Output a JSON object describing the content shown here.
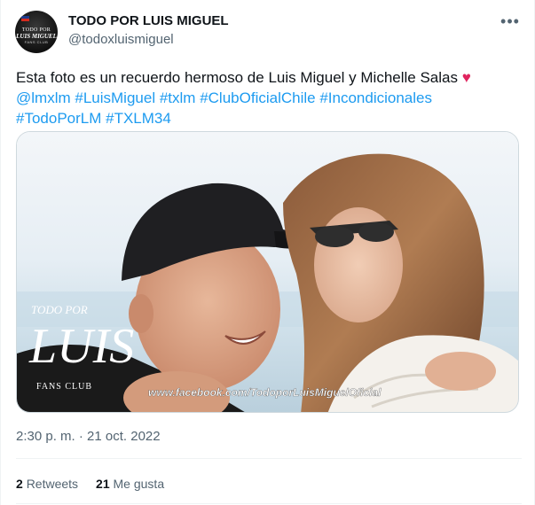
{
  "tweet": {
    "display_name": "TODO POR LUIS MIGUEL",
    "handle": "@todoxluismiguel",
    "avatar": {
      "line1": "TODO POR",
      "line2": "LUIS MIGUEL",
      "line3": "FANS CLUB"
    },
    "more_icon": "more-horizontal-icon",
    "text": "Esta foto es un recuerdo hermoso de Luis Miguel y Michelle Salas",
    "heart": "♥",
    "hashtags": [
      "@lmxlm",
      "#LuisMiguel",
      "#txlm",
      "#ClubOficialChile",
      "#Incondicionales",
      "#TodoPorLM",
      "#TXLM34"
    ],
    "timestamp": "2:30 p. m. · 21 oct. 2022",
    "retweets_count": "2",
    "retweets_label": "Retweets",
    "likes_count": "21",
    "likes_label": "Me gusta"
  },
  "media": {
    "watermark_line1": "TODO POR",
    "watermark_line2": "LUIS",
    "watermark_line3": "FANS CLUB",
    "watermark_url": "www.facebook.com/TodoporLuisMiguelOficial"
  },
  "colors": {
    "link": "#1d9bf0",
    "secondary": "#536471",
    "heart": "#e0245e"
  }
}
